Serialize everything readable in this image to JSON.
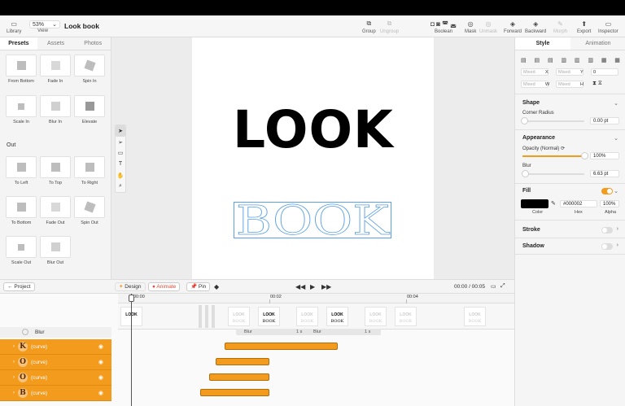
{
  "toolbar": {
    "zoom": "53%",
    "title": "Look book",
    "library": "Library",
    "view": "View",
    "group": "Group",
    "ungroup": "Ungroup",
    "boolean": "Boolean",
    "mask": "Mask",
    "unmask": "Unmask",
    "forward": "Forward",
    "backward": "Backward",
    "morph": "Morph",
    "export": "Export",
    "inspector": "Inspector"
  },
  "left": {
    "tabs": [
      "Presets",
      "Assets",
      "Photos"
    ],
    "presets_in": [
      "From Bottom",
      "Fade In",
      "Spin In",
      "Scale In",
      "Blur In",
      "Elevate"
    ],
    "out_label": "Out",
    "presets_out": [
      "To Left",
      "To Top",
      "To Right",
      "To Bottom",
      "Fade Out",
      "Spin Out",
      "Scale Out",
      "Blur Out"
    ]
  },
  "canvas": {
    "look_text": "LOOK",
    "book_text": "BOOK"
  },
  "right": {
    "tabs": [
      "Style",
      "Animation"
    ],
    "fields": {
      "x_ph": "Mixed",
      "x_lbl": "X",
      "y_ph": "Mixed",
      "y_lbl": "Y",
      "rot": "0",
      "w_ph": "Mixed",
      "w_lbl": "W",
      "h_ph": "Mixed",
      "h_lbl": "H"
    },
    "shape": "Shape",
    "corner_radius": "Corner Radius",
    "corner_value": "0.00 pt",
    "appearance": "Appearance",
    "opacity_label": "Opacity (Normal)",
    "opacity_value": "100%",
    "opacity_level": 1.0,
    "blur_label": "Blur",
    "blur_value": "6.63 pt",
    "blur_level": 0.05,
    "fill": "Fill",
    "fill_hex": "#000002",
    "fill_alpha": "100%",
    "color_lbl": "Color",
    "hex_lbl": "Hex",
    "alpha_lbl": "Alpha",
    "stroke": "Stroke",
    "shadow": "Shadow"
  },
  "bottom": {
    "project": "Project",
    "design": "Design",
    "animate": "Animate",
    "pin": "Pin",
    "time": "00:00 / 00:05"
  },
  "timeline": {
    "ticks": [
      "00:00",
      "00:02",
      "00:04"
    ],
    "blur_track": "Blur",
    "blur_a": "Blur",
    "blur_b": "Blur",
    "dur_a": "1 s",
    "dur_b": "1 s",
    "layers": [
      {
        "glyph": "K",
        "name": "(curve)"
      },
      {
        "glyph": "O",
        "name": "(curve)"
      },
      {
        "glyph": "O",
        "name": "(curve)"
      },
      {
        "glyph": "B",
        "name": "(curve)"
      }
    ],
    "frame_look": "LOOK",
    "frame_book": "BOOK"
  },
  "colors": {
    "accent": "#f29b1d",
    "selection": "#5aa0e6"
  }
}
